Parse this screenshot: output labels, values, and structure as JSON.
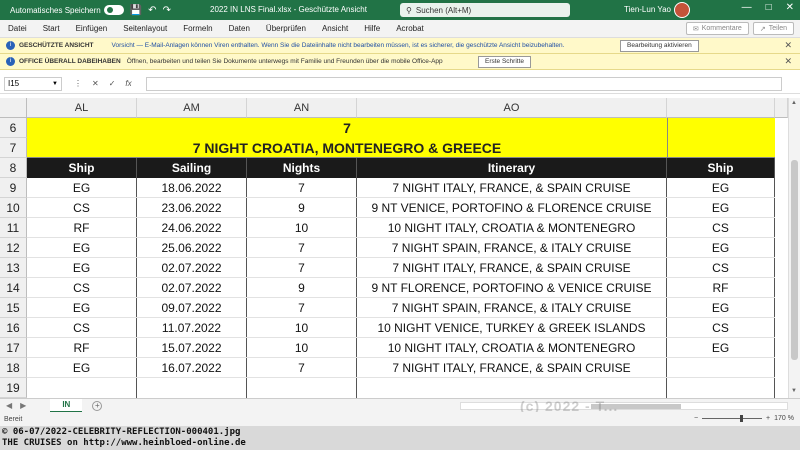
{
  "titlebar": {
    "autosave_label": "Automatisches Speichern",
    "filename": "2022 IN LNS Final.xlsx  -  Geschützte Ansicht",
    "search_placeholder": "Suchen (Alt+M)",
    "user_name": "Tien-Lun Yao"
  },
  "menu": {
    "items": [
      "Datei",
      "Start",
      "Einfügen",
      "Seitenlayout",
      "Formeln",
      "Daten",
      "Überprüfen",
      "Ansicht",
      "Hilfe",
      "Acrobat"
    ],
    "comments_label": "Kommentare",
    "share_label": "Teilen"
  },
  "infobar1": {
    "title": "GESCHÜTZTE ANSICHT",
    "text": "Vorsicht — E-Mail-Anlagen können Viren enthalten. Wenn Sie die Dateiinhalte nicht bearbeiten müssen, ist es sicherer, die geschützte Ansicht beizubehalten.",
    "button": "Bearbeitung aktivieren"
  },
  "infobar2": {
    "title": "OFFICE ÜBERALL DABEIHABEN",
    "text": "Öffnen, bearbeiten und teilen Sie Dokumente unterwegs mit Familie und Freunden über die mobile Office-App",
    "button": "Erste Schritte"
  },
  "formula": {
    "namebox": "I15",
    "fx": "fx"
  },
  "grid": {
    "columns": [
      "AL",
      "AM",
      "AN",
      "AO"
    ],
    "row_numbers": [
      "6",
      "7",
      "8",
      "9",
      "10",
      "11",
      "12",
      "13",
      "14",
      "15",
      "16",
      "17",
      "18",
      "19"
    ],
    "title_number": "7",
    "title_text": "7 NIGHT CROATIA, MONTENEGRO & GREECE",
    "headers": [
      "Ship",
      "Sailing",
      "Nights",
      "Itinerary",
      "Ship"
    ],
    "rows": [
      [
        "EG",
        "18.06.2022",
        "7",
        "7 NIGHT ITALY, FRANCE, & SPAIN CRUISE",
        "EG"
      ],
      [
        "CS",
        "23.06.2022",
        "9",
        "9 NT VENICE, PORTOFINO & FLORENCE CRUISE",
        "EG"
      ],
      [
        "RF",
        "24.06.2022",
        "10",
        "10 NIGHT ITALY, CROATIA & MONTENEGRO",
        "CS"
      ],
      [
        "EG",
        "25.06.2022",
        "7",
        "7 NIGHT SPAIN, FRANCE, & ITALY CRUISE",
        "EG"
      ],
      [
        "EG",
        "02.07.2022",
        "7",
        "7 NIGHT ITALY, FRANCE, & SPAIN CRUISE",
        "CS"
      ],
      [
        "CS",
        "02.07.2022",
        "9",
        "9 NT FLORENCE, PORTOFINO & VENICE CRUISE",
        "RF"
      ],
      [
        "EG",
        "09.07.2022",
        "7",
        "7 NIGHT SPAIN, FRANCE, & ITALY CRUISE",
        "EG"
      ],
      [
        "CS",
        "11.07.2022",
        "10",
        "10 NIGHT VENICE, TURKEY & GREEK ISLANDS",
        "CS"
      ],
      [
        "RF",
        "15.07.2022",
        "10",
        "10 NIGHT ITALY, CROATIA & MONTENEGRO",
        "EG"
      ],
      [
        "EG",
        "16.07.2022",
        "7",
        "7 NIGHT ITALY, FRANCE, & SPAIN CRUISE",
        ""
      ]
    ]
  },
  "sheet": {
    "tab": "IN",
    "watermark": "(c) 2022 - T..."
  },
  "status": {
    "ready": "Bereit",
    "zoom": "170 %"
  },
  "caption": {
    "line1": "© 06-07/2022-CELEBRITY-REFLECTION-000401.jpg",
    "line2": "THE CRUISES on http://www.heinbloed-online.de"
  }
}
